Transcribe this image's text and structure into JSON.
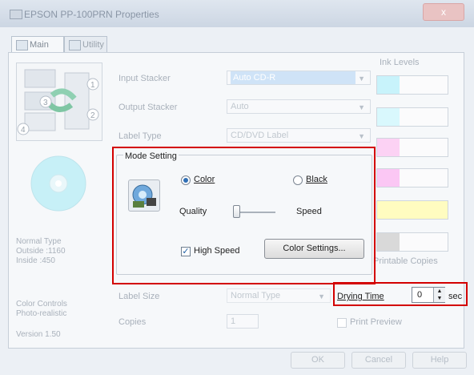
{
  "window": {
    "title": "EPSON PP-100PRN Properties",
    "close_label": "x"
  },
  "tabs": [
    {
      "label": "Main"
    },
    {
      "label": "Utility"
    }
  ],
  "left_panel": {
    "stacker_numbers": [
      "1",
      "2",
      "3",
      "4"
    ],
    "normal_type": "Normal Type",
    "outside": "Outside :1160",
    "inside": "Inside :450",
    "color_controls": "Color Controls",
    "photo_realistic": "Photo-realistic",
    "version": "Version 1.50"
  },
  "fields": {
    "input_stacker": {
      "label": "Input Stacker",
      "value": "Auto CD-R"
    },
    "output_stacker": {
      "label": "Output Stacker",
      "value": "Auto"
    },
    "label_type": {
      "label": "Label Type",
      "value": "CD/DVD Label"
    },
    "label_size": {
      "label": "Label Size",
      "value": "Normal Type"
    },
    "copies": {
      "label": "Copies",
      "value": "1"
    }
  },
  "ink_levels": {
    "title": "Ink Levels",
    "printable_copies": "Printable Copies",
    "colors": [
      "#c8f3fb",
      "#d9f8fd",
      "#fcd2f4",
      "#fbc7f4",
      "#fffcc0",
      "#d9d9d9"
    ]
  },
  "mode_setting": {
    "title": "Mode Setting",
    "color_label": "Color",
    "black_label": "Black",
    "quality_label": "Quality",
    "speed_label": "Speed",
    "high_speed_label": "High Speed",
    "color_settings_label": "Color Settings...",
    "selected": "Color",
    "high_speed_checked": true,
    "slider_position": 0
  },
  "drying_time": {
    "label": "Drying Time",
    "value": "0",
    "unit": "sec"
  },
  "print_preview": {
    "label": "Print Preview"
  },
  "buttons": {
    "ok": "OK",
    "cancel": "Cancel",
    "help": "Help"
  },
  "colors": {
    "highlight_red": "#d30000",
    "selection_blue": "#cfe3f7"
  },
  "icons": [
    "printer-app-icon",
    "main-tab-icon",
    "utility-tab-icon",
    "stacker-diagram-icon",
    "cd-disc-icon",
    "mode-setting-icon",
    "spin-up-icon",
    "spin-down-icon",
    "dropdown-arrow-icon"
  ]
}
